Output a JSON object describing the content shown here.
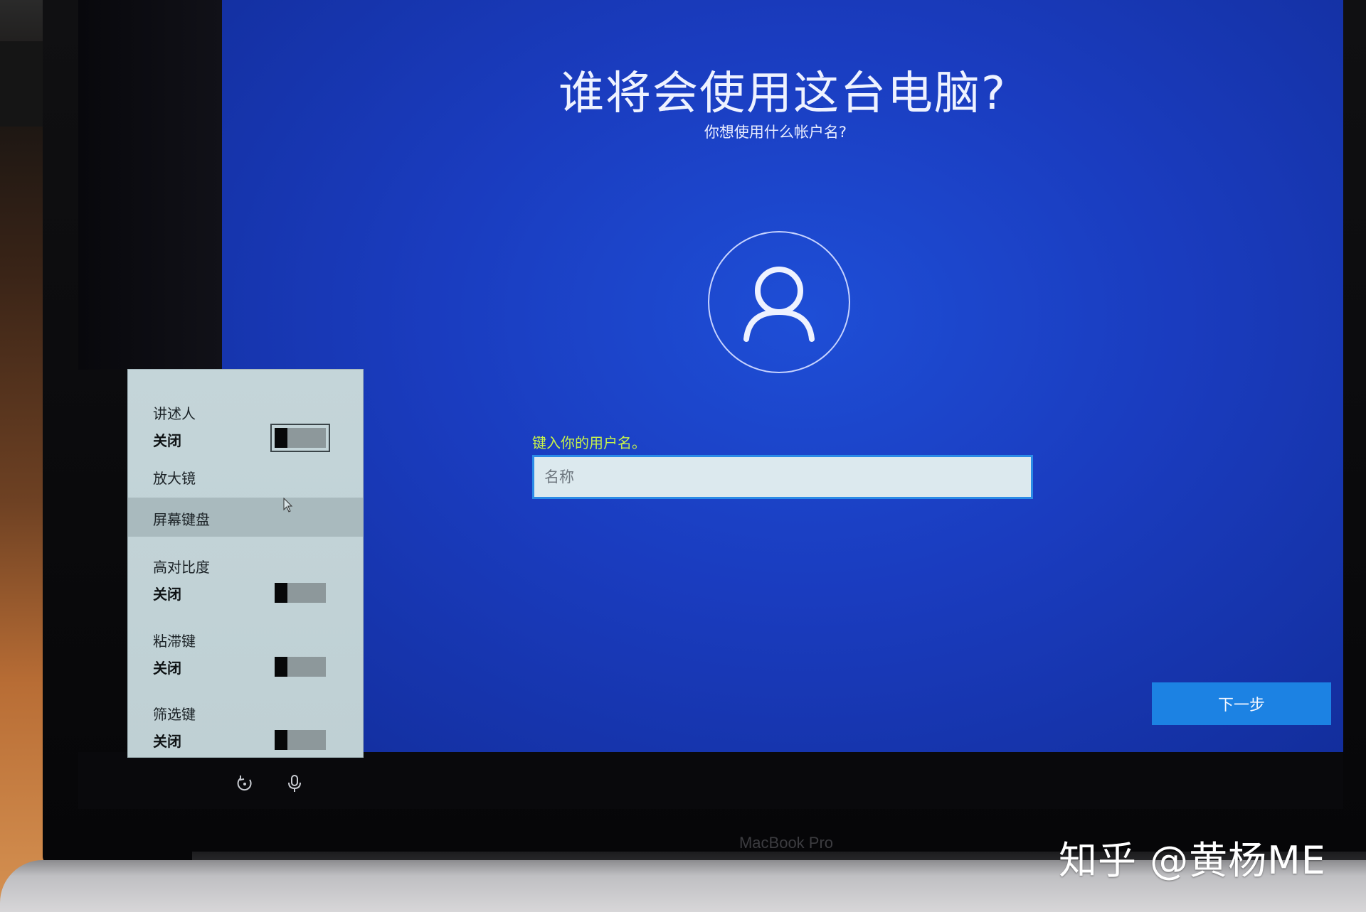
{
  "setup": {
    "title": "谁将会使用这台电脑?",
    "subtitle": "你想使用什么帐户名?",
    "field_label": "键入你的用户名。",
    "name_placeholder": "名称",
    "name_value": "",
    "next_label": "下一步"
  },
  "accessibility_menu": {
    "items": [
      {
        "label": "讲述人",
        "state": "关闭",
        "toggle_on": false
      },
      {
        "label": "放大镜"
      },
      {
        "label": "屏幕键盘"
      },
      {
        "label": "高对比度",
        "state": "关闭",
        "toggle_on": false
      },
      {
        "label": "粘滞键",
        "state": "关闭",
        "toggle_on": false
      },
      {
        "label": "筛选键",
        "state": "关闭",
        "toggle_on": false
      }
    ]
  },
  "tray": {
    "icons": [
      "accessibility-icon",
      "microphone-icon"
    ]
  },
  "device_label": "MacBook Pro",
  "watermark": "知乎 @黄杨ME",
  "colors": {
    "background_blue": "#1a3cbf",
    "next_button": "#1c82e3",
    "field_label": "#c6f24a",
    "input_border": "#2b8be6",
    "flyout_bg": "#c4d5d9"
  }
}
